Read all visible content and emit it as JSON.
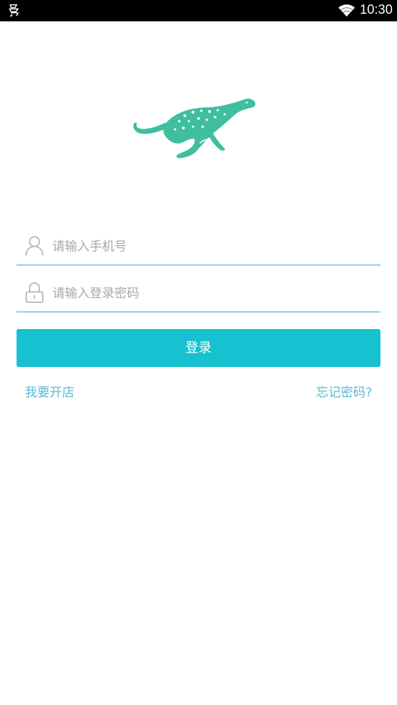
{
  "status_bar": {
    "time": "10:30",
    "left_icon": "app-notification-icon",
    "wifi_icon": "wifi-icon"
  },
  "logo": {
    "icon": "cheetah-logo",
    "color": "#3fbf9f"
  },
  "form": {
    "phone": {
      "icon": "user-icon",
      "placeholder": "请输入手机号",
      "value": ""
    },
    "password": {
      "icon": "lock-icon",
      "placeholder": "请输入登录密码",
      "value": ""
    },
    "login_label": "登录"
  },
  "links": {
    "open_store": "我要开店",
    "forgot_password": "忘记密码?"
  },
  "colors": {
    "accent": "#16c2cf",
    "link": "#5bb7d6",
    "underline": "#8ccfe3"
  }
}
